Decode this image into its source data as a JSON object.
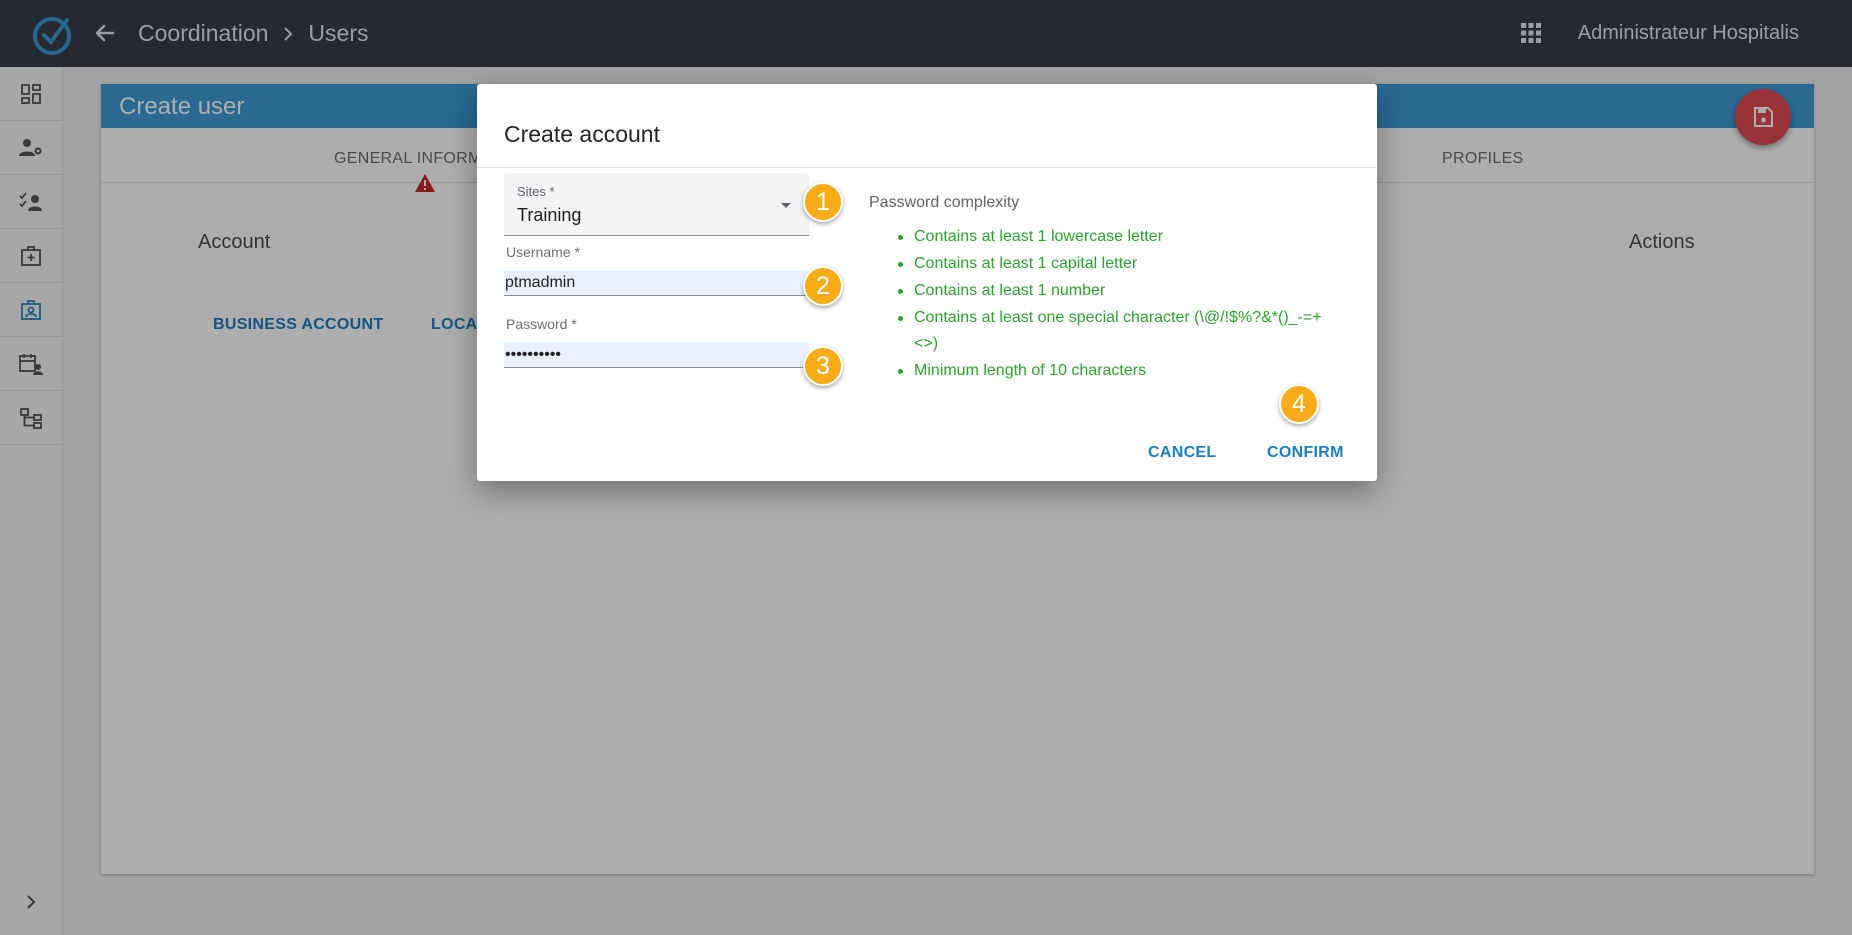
{
  "header": {
    "breadcrumb": [
      "Coordination",
      "Users"
    ],
    "user_name": "Administrateur Hospitalis"
  },
  "sidebar": {
    "items": [
      {
        "icon": "dashboard-icon"
      },
      {
        "icon": "user-settings-icon"
      },
      {
        "icon": "user-checklist-icon"
      },
      {
        "icon": "medical-kit-icon"
      },
      {
        "icon": "badge-id-icon",
        "active": true
      },
      {
        "icon": "calendar-user-icon"
      },
      {
        "icon": "hierarchy-icon"
      }
    ]
  },
  "page": {
    "title": "Create user",
    "tabs": [
      "GENERAL INFORMA",
      "PROFILES"
    ],
    "column_account": "Account",
    "column_actions": "Actions",
    "btn_business_account": "BUSINESS ACCOUNT",
    "btn_local_account": "LOCA"
  },
  "dialog": {
    "title": "Create account",
    "sites_label": "Sites *",
    "sites_value": "Training",
    "username_label": "Username *",
    "username_value": "ptmadmin",
    "password_label": "Password *",
    "password_value": "••••••••••",
    "complexity_title": "Password complexity",
    "rules": [
      "Contains at least 1 lowercase letter",
      "Contains at least 1 capital letter",
      "Contains at least 1 number",
      "Contains at least one special character (\\@/!$%?&*()_-=+<>)",
      "Minimum length of 10 characters"
    ],
    "cancel_label": "CANCEL",
    "confirm_label": "CONFIRM"
  },
  "annotations": [
    "1",
    "2",
    "3",
    "4"
  ],
  "colors": {
    "topbar": "#373e49",
    "header_blue": "#3d9bd8",
    "link_blue": "#1a7fc1",
    "rule_green": "#2aa32a",
    "badge_orange": "#f9ac18",
    "fab_red": "#e24a55"
  }
}
